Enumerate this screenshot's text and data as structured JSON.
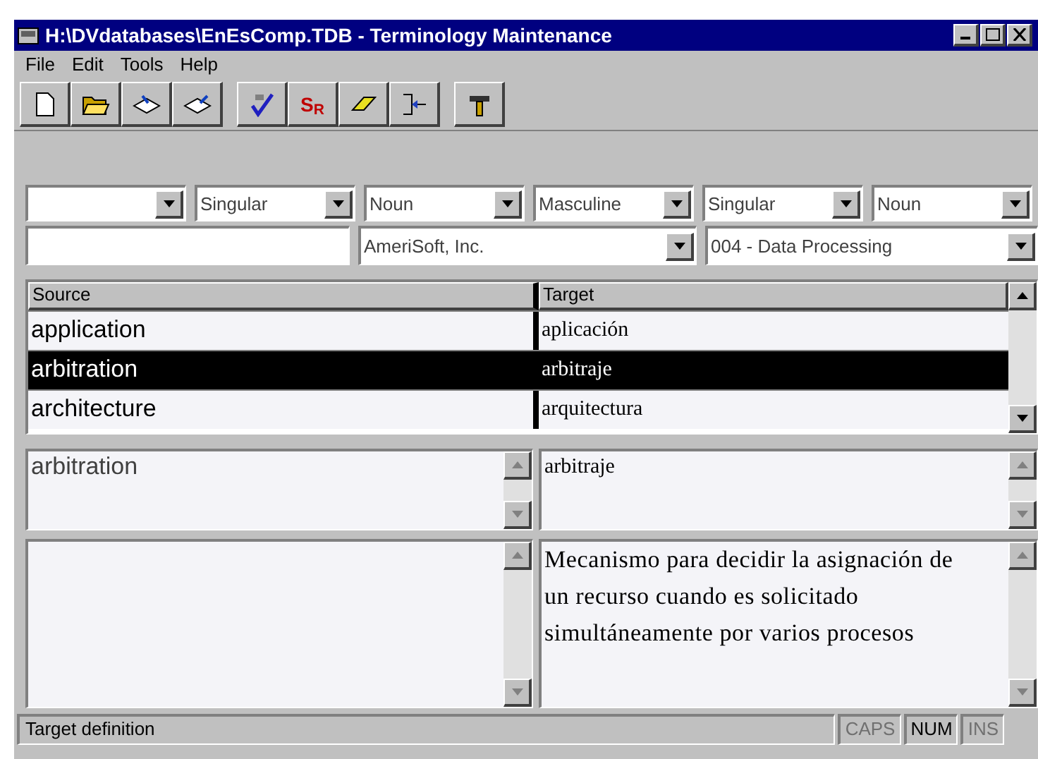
{
  "window": {
    "title": "H:\\DVdatabases\\EnEsComp.TDB - Terminology Maintenance"
  },
  "menu": [
    "File",
    "Edit",
    "Tools",
    "Help"
  ],
  "toolbar": [
    {
      "kind": "new"
    },
    {
      "kind": "open"
    },
    {
      "kind": "book-in"
    },
    {
      "kind": "book-out"
    },
    {
      "kind": "gap"
    },
    {
      "kind": "spell"
    },
    {
      "kind": "sr",
      "label": "S$_{R}$"
    },
    {
      "kind": "eraser"
    },
    {
      "kind": "merge"
    },
    {
      "kind": "gap"
    },
    {
      "kind": "hammer"
    }
  ],
  "combos_row_1": [
    {
      "kind": "combo"
    },
    {
      "kind": "combo",
      "value": "Singular"
    },
    {
      "kind": "combo",
      "value": "Noun"
    },
    {
      "kind": "combo",
      "value": "Masculine"
    },
    {
      "kind": "combo",
      "value": "Singular"
    },
    {
      "kind": "combo",
      "value": "Noun"
    }
  ],
  "combos_row_2": [
    {
      "kind": "field"
    },
    {
      "kind": "combo",
      "value": "AmeriSoft, Inc."
    },
    {
      "kind": "combo",
      "value": "004 - Data Processing"
    }
  ],
  "table": {
    "columns": [
      "Source",
      "Target"
    ],
    "rows": [
      {
        "source": "application",
        "target": "aplicación",
        "selected": false
      },
      {
        "source": "arbitration",
        "target": "arbitraje",
        "selected": true
      },
      {
        "source": "architecture",
        "target": "arquitectura",
        "selected": false
      }
    ]
  },
  "term_source": "arbitration",
  "term_target": "arbitraje",
  "definition_target": "Mecanismo para decidir la asignación de un recurso cuando es solicitado simultáneamente por varios procesos",
  "status_bar": {
    "text": "Target definition",
    "indicators": [
      {
        "label": "CAPS",
        "disabled": true
      },
      {
        "label": "NUM",
        "disabled": false
      },
      {
        "label": "INS",
        "disabled": true
      }
    ]
  }
}
